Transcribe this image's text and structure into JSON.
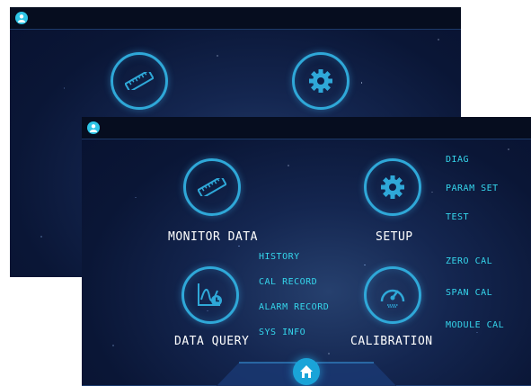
{
  "colors": {
    "background": "#0e1d45",
    "accent": "#2fa8d8",
    "link_text": "#35d6ec",
    "label_text": "#ffffff"
  },
  "back_screen": {
    "icons": [
      "ruler-icon",
      "gear-icon"
    ]
  },
  "front_screen": {
    "modules": {
      "monitor_data": {
        "label": "MONITOR DATA",
        "icon": "ruler-icon"
      },
      "setup": {
        "label": "SETUP",
        "icon": "gear-icon",
        "links": [
          "DIAG",
          "PARAM SET",
          "TEST"
        ]
      },
      "data_query": {
        "label": "DATA QUERY",
        "icon": "chart-clock-icon",
        "links": [
          "HISTORY",
          "CAL RECORD",
          "ALARM RECORD",
          "SYS INFO"
        ]
      },
      "calibration": {
        "label": "CALIBRATION",
        "icon": "gauge-icon",
        "links": [
          "ZERO CAL",
          "SPAN CAL",
          "MODULE CAL"
        ]
      }
    },
    "home_icon": "home-icon",
    "user_icon": "user-icon"
  }
}
